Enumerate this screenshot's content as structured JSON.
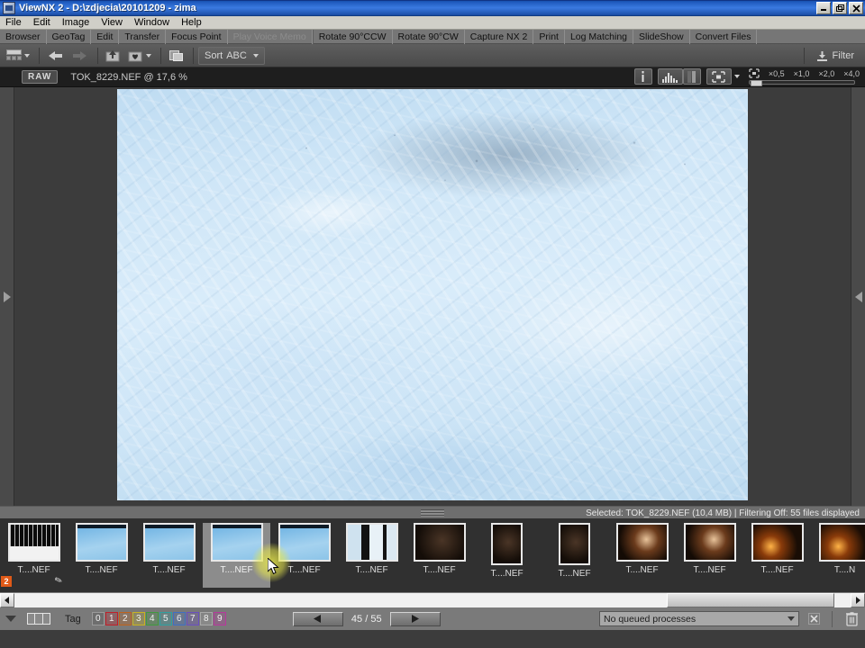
{
  "window": {
    "title": "ViewNX 2 - D:\\zdjecia\\20101209 - zima",
    "icon": "app-icon",
    "minimize": "_",
    "restore": "❐",
    "close": "✕"
  },
  "menubar": {
    "items": [
      {
        "label": "File"
      },
      {
        "label": "Edit"
      },
      {
        "label": "Image"
      },
      {
        "label": "View"
      },
      {
        "label": "Window"
      },
      {
        "label": "Help"
      }
    ]
  },
  "navbar": {
    "items": [
      {
        "label": "Browser",
        "disabled": false
      },
      {
        "label": "GeoTag",
        "disabled": false
      },
      {
        "label": "Edit",
        "disabled": false
      },
      {
        "label": "Transfer",
        "disabled": false
      },
      {
        "label": "Focus Point",
        "disabled": false
      },
      {
        "label": "Play Voice Memo",
        "disabled": true
      },
      {
        "label": "Rotate 90°CCW",
        "disabled": false
      },
      {
        "label": "Rotate 90°CW",
        "disabled": false
      },
      {
        "label": "Capture NX 2",
        "disabled": false
      },
      {
        "label": "Print",
        "disabled": false
      },
      {
        "label": "Log Matching",
        "disabled": false
      },
      {
        "label": "SlideShow",
        "disabled": false
      },
      {
        "label": "Convert Files",
        "disabled": false
      }
    ]
  },
  "toolbar": {
    "thumbnail_view_icon": "thumbnail-grid-icon",
    "back_icon": "back-arrow-icon",
    "forward_icon": "forward-arrow-icon",
    "up_folder_icon": "up-folder-icon",
    "favorites_icon": "add-favorite-icon",
    "copy_icon": "copy-icon",
    "sort_label": "Sort",
    "sort_value": "ABC",
    "filter_label": "Filter",
    "filter_icon": "filter-icon"
  },
  "image_header": {
    "format_badge": "RAW",
    "filename_zoom": "TOK_8229.NEF @ 17,6 %",
    "info_icon": "info-icon",
    "histogram_icon": "histogram-icon",
    "fit_icon": "fit-to-screen-icon",
    "zoom_reset_icon": "zoom-reset-icon",
    "zoom_stops": [
      "×0,5",
      "×1,0",
      "×2,0",
      "×4,0"
    ]
  },
  "viewer": {
    "left_panel_arrow": "expand-left-panel-icon",
    "right_panel_arrow": "expand-right-panel-icon",
    "photo_alt": "snow-photo"
  },
  "status": {
    "grip": "splitter-grip",
    "text": "Selected: TOK_8229.NEF (10,4 MB) | Filtering Off: 55 files displayed"
  },
  "filmstrip": {
    "thumbs": [
      {
        "label": "T....NEF",
        "art": "trees",
        "orient": "land",
        "rating": "2",
        "brush": "✎",
        "selected": false
      },
      {
        "label": "T....NEF",
        "art": "snow",
        "orient": "land",
        "selected": false
      },
      {
        "label": "T....NEF",
        "art": "snow",
        "orient": "land",
        "selected": false
      },
      {
        "label": "T....NEF",
        "art": "snow",
        "orient": "land",
        "selected": true
      },
      {
        "label": "T....NEF",
        "art": "snow",
        "orient": "land",
        "selected": false
      },
      {
        "label": "T....NEF",
        "art": "win",
        "orient": "land",
        "selected": false
      },
      {
        "label": "T....NEF",
        "art": "dark",
        "orient": "land",
        "selected": false
      },
      {
        "label": "T....NEF",
        "art": "dark",
        "orient": "port",
        "selected": false
      },
      {
        "label": "T....NEF",
        "art": "dark",
        "orient": "port",
        "selected": false
      },
      {
        "label": "T....NEF",
        "art": "boy",
        "orient": "land",
        "selected": false
      },
      {
        "label": "T....NEF",
        "art": "boy",
        "orient": "land",
        "selected": false
      },
      {
        "label": "T....NEF",
        "art": "fire",
        "orient": "land",
        "selected": false
      },
      {
        "label": "T....N",
        "art": "fire",
        "orient": "land",
        "selected": false
      }
    ],
    "cursor": "mouse-pointer"
  },
  "scrollbar": {
    "left_arrow": "◀",
    "right_arrow": "▶"
  },
  "bottombar": {
    "view_toggle_icon": "view-mode-caret-icon",
    "filmstrip_icon": "filmstrip-layout-icon",
    "tag_label": "Tag",
    "tags": [
      {
        "label": "0",
        "color": "#9a9a9a"
      },
      {
        "label": "1",
        "color": "#c2202a"
      },
      {
        "label": "2",
        "color": "#c0631c"
      },
      {
        "label": "3",
        "color": "#c9b320"
      },
      {
        "label": "4",
        "color": "#3f9b3f"
      },
      {
        "label": "5",
        "color": "#2fa0a0"
      },
      {
        "label": "6",
        "color": "#3f6fc4"
      },
      {
        "label": "7",
        "color": "#6a4fbf"
      },
      {
        "label": "8",
        "color": "#a8a8a8"
      },
      {
        "label": "9",
        "color": "#b6399c"
      }
    ],
    "prev_icon": "◀",
    "next_icon": "▶",
    "counter": "45 / 55",
    "queue_value": "No queued processes",
    "cancel_icon": "cancel-icon",
    "delete_icon": "trash-icon"
  }
}
